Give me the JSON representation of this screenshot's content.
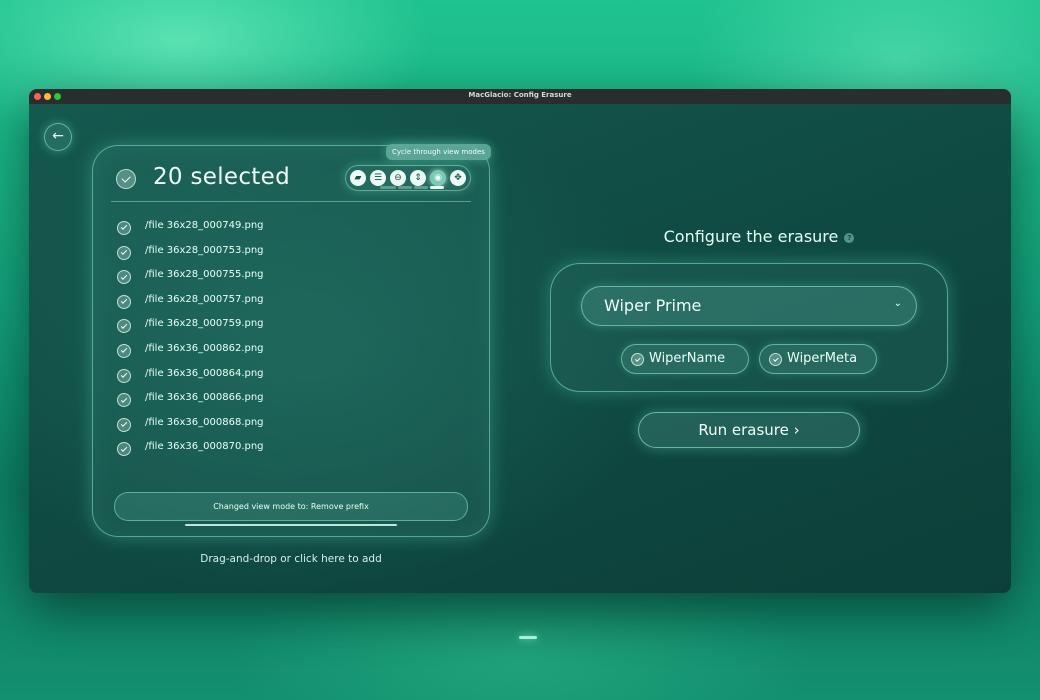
{
  "window": {
    "title": "MacGlacio: Config Erasure"
  },
  "nav": {
    "back_symbol": "←"
  },
  "selection": {
    "count_label": "20 selected",
    "tooltip": "Cycle through view modes",
    "toolbar_icons": [
      "folder-icon",
      "list-icon",
      "minus-circle-icon",
      "sort-icon",
      "eye-icon",
      "expand-icon"
    ],
    "active_view_mode_index": 4,
    "page_count": 4,
    "active_page_index": 3
  },
  "files": [
    "/file 36x28_000749.png",
    "/file 36x28_000753.png",
    "/file 36x28_000755.png",
    "/file 36x28_000757.png",
    "/file 36x28_000759.png",
    "/file 36x36_000862.png",
    "/file 36x36_000864.png",
    "/file 36x36_000866.png",
    "/file 36x36_000868.png",
    "/file 36x36_000870.png"
  ],
  "status": {
    "message": "Changed view mode to: Remove prefix"
  },
  "drop_hint": "Drag-and-drop or click here to add",
  "config": {
    "title": "Configure the erasure",
    "help_symbol": "?",
    "preset": "Wiper Prime",
    "options": [
      {
        "label": "WiperName",
        "checked": true
      },
      {
        "label": "WiperMeta",
        "checked": true
      }
    ]
  },
  "run_button": {
    "label": "Run erasure ›"
  },
  "colors": {
    "accent": "#7fffd4",
    "panel_border": "#8cebcd",
    "window_bg": "#0f4a42"
  }
}
